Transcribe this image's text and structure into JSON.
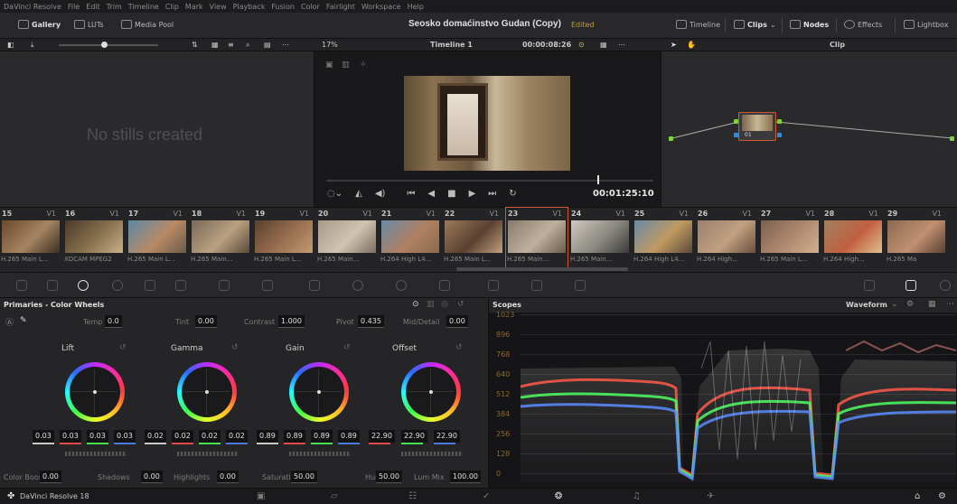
{
  "menu": [
    "DaVinci Resolve",
    "File",
    "Edit",
    "Trim",
    "Timeline",
    "Clip",
    "Mark",
    "View",
    "Playback",
    "Fusion",
    "Color",
    "Fairlight",
    "Workspace",
    "Help"
  ],
  "topbar": {
    "gallery": "Gallery",
    "luts": "LUTs",
    "media_pool": "Media Pool",
    "project_title": "Seosko domaćinstvo Gudan (Copy)",
    "edited": "Edited",
    "timeline": "Timeline",
    "clips": "Clips",
    "nodes": "Nodes",
    "effects": "Effects",
    "lightbox": "Lightbox"
  },
  "subbar": {
    "zoom": "17%",
    "timeline_name": "Timeline 1",
    "timecode": "00:00:08:26",
    "clip_mode": "Clip"
  },
  "gallery": {
    "empty_text": "No stills created"
  },
  "viewer": {
    "timecode": "00:01:25:10",
    "progress": 0.83
  },
  "nodes": {
    "node_label": "01"
  },
  "clips": [
    {
      "num": "15",
      "track": "V1",
      "codec": "H.265 Main L...",
      "colors": [
        "#6b4a2c",
        "#a58460",
        "#3d2e22"
      ]
    },
    {
      "num": "16",
      "track": "V1",
      "codec": "XDCAM MPEG2",
      "colors": [
        "#4a3a2a",
        "#8a7250",
        "#c8b088"
      ]
    },
    {
      "num": "17",
      "track": "V1",
      "codec": "H.265 Main L...",
      "colors": [
        "#5a8aa6",
        "#b98a64",
        "#6a5a4a"
      ]
    },
    {
      "num": "18",
      "track": "V1",
      "codec": "H.265 Main...",
      "colors": [
        "#7a6a5a",
        "#b9a080",
        "#5a4a3a"
      ]
    },
    {
      "num": "19",
      "track": "V1",
      "codec": "H.265 Main L...",
      "colors": [
        "#5a4030",
        "#9a7050",
        "#c09a70"
      ]
    },
    {
      "num": "20",
      "track": "V1",
      "codec": "H.265 Main...",
      "colors": [
        "#a69a88",
        "#d0c4b0",
        "#7a6e60"
      ]
    },
    {
      "num": "21",
      "track": "V1",
      "codec": "H.264 High L4...",
      "colors": [
        "#6a8aa6",
        "#b08060",
        "#8a6a50"
      ]
    },
    {
      "num": "22",
      "track": "V1",
      "codec": "H.265 Main L...",
      "colors": [
        "#9a7a5a",
        "#5a4030",
        "#c0a080"
      ]
    },
    {
      "num": "23",
      "track": "V1",
      "codec": "H.265 Main...",
      "colors": [
        "#8a7a6a",
        "#c0b0a0",
        "#6a5a4a"
      ]
    },
    {
      "num": "24",
      "track": "V1",
      "codec": "H.265 Main...",
      "colors": [
        "#d0c8c0",
        "#8a8880",
        "#3a3a38"
      ]
    },
    {
      "num": "25",
      "track": "V1",
      "codec": "H.264 High L4...",
      "colors": [
        "#6a8aa6",
        "#c09a60",
        "#5a4a3a"
      ]
    },
    {
      "num": "26",
      "track": "V1",
      "codec": "H.264 High...",
      "colors": [
        "#9a8070",
        "#c0a080",
        "#6a5040"
      ]
    },
    {
      "num": "27",
      "track": "V1",
      "codec": "H.265 Main L...",
      "colors": [
        "#7a6050",
        "#b08a70",
        "#d0b090"
      ]
    },
    {
      "num": "28",
      "track": "V1",
      "codec": "H.264 High...",
      "colors": [
        "#a08060",
        "#c06040",
        "#e0c090"
      ]
    },
    {
      "num": "29",
      "track": "V1",
      "codec": "H.265 Ma",
      "colors": [
        "#8a6a50",
        "#c09070",
        "#5a4030"
      ]
    }
  ],
  "primaries": {
    "title": "Primaries - Color Wheels",
    "temp_label": "Temp",
    "temp": "0.0",
    "tint_label": "Tint",
    "tint": "0.00",
    "contrast_label": "Contrast",
    "contrast": "1.000",
    "pivot_label": "Pivot",
    "pivot": "0.435",
    "middetail_label": "Mid/Detail",
    "middetail": "0.00",
    "wheels": [
      {
        "name": "Lift",
        "values": [
          "0.03",
          "0.03",
          "0.03",
          "0.03"
        ]
      },
      {
        "name": "Gamma",
        "values": [
          "0.02",
          "0.02",
          "0.02",
          "0.02"
        ]
      },
      {
        "name": "Gain",
        "values": [
          "0.89",
          "0.89",
          "0.89",
          "0.89"
        ]
      },
      {
        "name": "Offset",
        "values": [
          "22.90",
          "22.90",
          "22.90"
        ]
      }
    ],
    "colorboost_label": "Color Boost",
    "colorboost": "0.00",
    "shadows_label": "Shadows",
    "shadows": "0.00",
    "highlights_label": "Highlights",
    "highlights": "0.00",
    "saturation_label": "Saturation",
    "saturation": "50.00",
    "hue_label": "Hue",
    "hue": "50.00",
    "lummix_label": "Lum Mix",
    "lummix": "100.00"
  },
  "scopes": {
    "title": "Scopes",
    "mode": "Waveform",
    "ylabels": [
      "1023",
      "896",
      "768",
      "640",
      "512",
      "384",
      "256",
      "128",
      "0"
    ]
  },
  "taskbar": {
    "app_name": "DaVinci Resolve 18"
  },
  "colors": {
    "accent": "#c9592e",
    "edited": "#c9a227"
  }
}
